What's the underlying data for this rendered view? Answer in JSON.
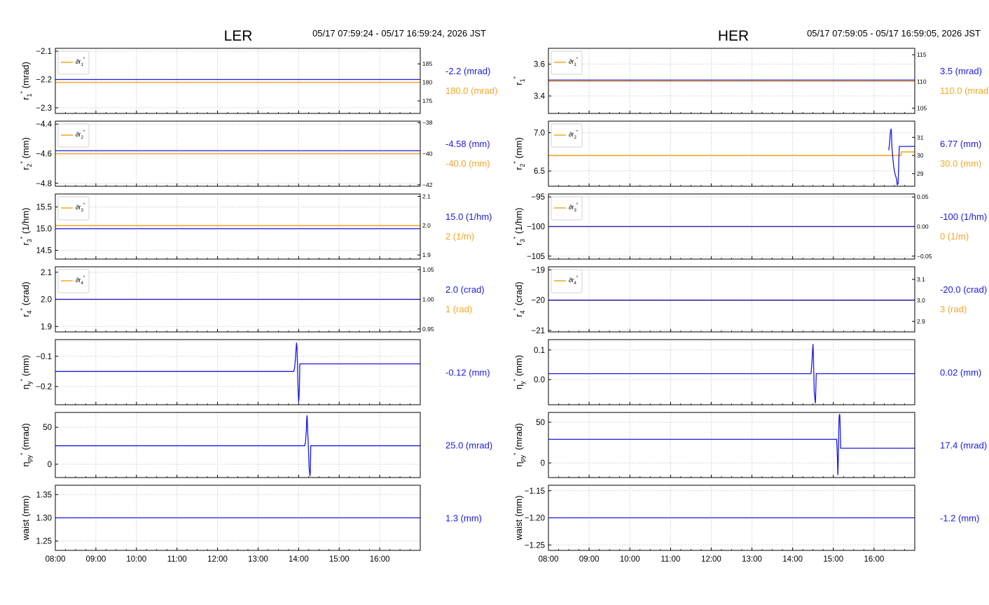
{
  "colors": {
    "blue": "#1a1ae6",
    "orange": "#f5a623",
    "grid": "#cccccc"
  },
  "x_ticks": [
    "08:00",
    "09:00",
    "10:00",
    "11:00",
    "12:00",
    "13:00",
    "14:00",
    "15:00",
    "16:00"
  ],
  "chart_data": [
    {
      "panel": "LER",
      "title": "LER",
      "date_range": "05/17 07:59:24 - 05/17 16:59:24, 2026 JST",
      "rows": [
        {
          "ylabel_main": "r",
          "ylabel_sub": "1",
          "ylabel_unit": "(mrad)",
          "ylim": [
            -2.32,
            -2.09
          ],
          "yticks": [
            -2.1,
            -2.2,
            -2.3
          ],
          "yticklabels": [
            "−2.1",
            "−2.2",
            "−2.3"
          ],
          "right_ylim": [
            171.6,
            189.2
          ],
          "right_yticks": [
            185,
            180,
            175
          ],
          "right_yticklabels": [
            "185",
            "180",
            "175"
          ],
          "legend": "∂r",
          "legend_sub": "1",
          "orange": [
            [
              0,
              180
            ],
            [
              9,
              180
            ]
          ],
          "blue": [
            [
              0,
              -2.2
            ],
            [
              9,
              -2.2
            ]
          ],
          "value_blue": "-2.2 (mrad)",
          "value_orange": "180.0 (mrad)"
        },
        {
          "ylabel_main": "r",
          "ylabel_sub": "2",
          "ylabel_unit": "(mm)",
          "ylim": [
            -4.82,
            -4.38
          ],
          "yticks": [
            -4.4,
            -4.6,
            -4.8
          ],
          "yticklabels": [
            "−4.4",
            "−4.6",
            "−4.8"
          ],
          "right_ylim": [
            -42.1,
            -37.9
          ],
          "right_yticks": [
            -38,
            -40,
            -42
          ],
          "right_yticklabels": [
            "−38",
            "−40",
            "−42"
          ],
          "legend": "∂r",
          "legend_sub": "2",
          "orange": [
            [
              0,
              -40
            ],
            [
              9,
              -40
            ]
          ],
          "blue": [
            [
              0,
              -4.58
            ],
            [
              9,
              -4.58
            ]
          ],
          "value_blue": "-4.58 (mm)",
          "value_orange": "-40.0 (mm)"
        },
        {
          "ylabel_main": "r",
          "ylabel_sub": "3",
          "ylabel_unit": "(1/hm)",
          "ylim": [
            14.3,
            15.8
          ],
          "yticks": [
            15.5,
            15.0,
            14.5
          ],
          "yticklabels": [
            "15.5",
            "15.0",
            "14.5"
          ],
          "right_ylim": [
            1.886,
            2.108
          ],
          "right_yticks": [
            2.1,
            2.0,
            1.9
          ],
          "right_yticklabels": [
            "2.1",
            "2.0",
            "1.9"
          ],
          "legend": "∂r",
          "legend_sub": "3",
          "orange": [
            [
              0,
              2.0
            ],
            [
              9,
              2.0
            ]
          ],
          "blue": [
            [
              0,
              15.0
            ],
            [
              9,
              15.0
            ]
          ],
          "value_blue": "15.0 (1/hm)",
          "value_orange": "2 (1/m)"
        },
        {
          "ylabel_main": "r",
          "ylabel_sub": "4",
          "ylabel_unit": "(crad)",
          "ylim": [
            1.88,
            2.12
          ],
          "yticks": [
            2.1,
            2.0,
            1.9
          ],
          "yticklabels": [
            "2.1",
            "2.0",
            "1.9"
          ],
          "right_ylim": [
            0.945,
            1.055
          ],
          "right_yticks": [
            1.05,
            1.0,
            0.95
          ],
          "right_yticklabels": [
            "1.05",
            "1.00",
            "0.95"
          ],
          "legend": "∂r",
          "legend_sub": "4",
          "orange": [
            [
              0,
              1.0
            ],
            [
              9,
              1.0
            ]
          ],
          "blue": [
            [
              0,
              2.0
            ],
            [
              9,
              2.0
            ]
          ],
          "value_blue": "2.0 (crad)",
          "value_orange": "1 (rad)"
        },
        {
          "ylabel_main": "η",
          "ylabel_sub": "y",
          "ylabel_unit": "(mm)",
          "ylim": [
            -0.26,
            -0.045
          ],
          "yticks": [
            -0.1,
            -0.2
          ],
          "yticklabels": [
            "−0.1",
            "−0.2"
          ],
          "blue": [
            [
              0,
              -0.15
            ],
            [
              5.88,
              -0.15
            ],
            [
              5.9,
              -0.14
            ],
            [
              5.92,
              -0.11
            ],
            [
              5.94,
              -0.07
            ],
            [
              5.95,
              -0.055
            ],
            [
              5.96,
              -0.07
            ],
            [
              5.97,
              -0.12
            ],
            [
              5.98,
              -0.18
            ],
            [
              5.99,
              -0.22
            ],
            [
              6.0,
              -0.25
            ],
            [
              6.01,
              -0.24
            ],
            [
              6.02,
              -0.2
            ],
            [
              6.03,
              -0.125
            ],
            [
              9,
              -0.125
            ]
          ],
          "value_blue": "-0.12 (mm)"
        },
        {
          "ylabel_main": "η",
          "ylabel_sub": "py",
          "ylabel_unit": "(mrad)",
          "ylim": [
            -18,
            70
          ],
          "yticks": [
            50,
            0
          ],
          "yticklabels": [
            "50",
            "0"
          ],
          "blue": [
            [
              0,
              25
            ],
            [
              6.15,
              25
            ],
            [
              6.17,
              30
            ],
            [
              6.19,
              45
            ],
            [
              6.2,
              62
            ],
            [
              6.21,
              66
            ],
            [
              6.22,
              50
            ],
            [
              6.24,
              25
            ],
            [
              6.26,
              -5
            ],
            [
              6.28,
              -16
            ],
            [
              6.29,
              -10
            ],
            [
              6.3,
              25
            ],
            [
              9,
              25
            ]
          ],
          "value_blue": "25.0 (mrad)"
        },
        {
          "ylabel_main": "waist",
          "ylabel_sub": "",
          "ylabel_unit": "(mm)",
          "ylim": [
            1.23,
            1.37
          ],
          "yticks": [
            1.35,
            1.3,
            1.25
          ],
          "yticklabels": [
            "1.35",
            "1.30",
            "1.25"
          ],
          "blue": [
            [
              0,
              1.3
            ],
            [
              9,
              1.3
            ]
          ],
          "value_blue": "1.3 (mm)"
        }
      ]
    },
    {
      "panel": "HER",
      "title": "HER",
      "date_range": "05/17 07:59:05 - 05/17 16:59:05, 2026 JST",
      "rows": [
        {
          "ylabel_main": "r",
          "ylabel_sub": "1",
          "ylabel_unit": "",
          "ylim": [
            3.29,
            3.7
          ],
          "yticks": [
            3.6,
            3.4
          ],
          "yticklabels": [
            "3.6",
            "3.4"
          ],
          "right_ylim": [
            104.0,
            116.2
          ],
          "right_yticks": [
            115,
            110,
            105
          ],
          "right_yticklabels": [
            "115",
            "110",
            "105"
          ],
          "legend": "∂r",
          "legend_sub": "1",
          "orange": [
            [
              0,
              110
            ],
            [
              9,
              110
            ]
          ],
          "blue": [
            [
              0,
              3.5
            ],
            [
              9,
              3.5
            ]
          ],
          "value_blue": "3.5 (mrad)",
          "value_orange": "110.0 (mrad)"
        },
        {
          "ylabel_main": "r",
          "ylabel_sub": "2",
          "ylabel_unit": "(mm)",
          "ylim": [
            6.3,
            7.15
          ],
          "yticks": [
            7.0,
            6.5
          ],
          "yticklabels": [
            "7.0",
            "6.5"
          ],
          "right_ylim": [
            28.3,
            31.9
          ],
          "right_yticks": [
            31,
            30,
            29
          ],
          "right_yticklabels": [
            "31",
            "30",
            "29"
          ],
          "legend": "∂r",
          "legend_sub": "2",
          "orange": [
            [
              0,
              30
            ],
            [
              8.66,
              30
            ],
            [
              8.67,
              30.2
            ],
            [
              9,
              30.2
            ]
          ],
          "blue": [
            [
              8.36,
              6.77
            ],
            [
              8.38,
              6.85
            ],
            [
              8.4,
              7.0
            ],
            [
              8.42,
              7.05
            ],
            [
              8.43,
              6.95
            ],
            [
              8.44,
              6.8
            ],
            [
              8.46,
              6.68
            ],
            [
              8.48,
              6.57
            ],
            [
              8.5,
              6.5
            ],
            [
              8.52,
              6.45
            ],
            [
              8.55,
              6.4
            ],
            [
              8.57,
              6.32
            ],
            [
              8.59,
              6.33
            ],
            [
              8.61,
              6.65
            ],
            [
              8.62,
              6.82
            ],
            [
              9,
              6.82
            ]
          ],
          "value_blue": "6.77 (mm)",
          "value_orange": "30.0 (mm)"
        },
        {
          "ylabel_main": "r",
          "ylabel_sub": "3",
          "ylabel_unit": "(1/hm)",
          "ylim": [
            -105.5,
            -94.5
          ],
          "yticks": [
            -95,
            -100,
            -105
          ],
          "yticklabels": [
            "−95",
            "−100",
            "−105"
          ],
          "right_ylim": [
            -0.055,
            0.055
          ],
          "right_yticks": [
            0.05,
            0.0,
            -0.05
          ],
          "right_yticklabels": [
            "0.05",
            "0.00",
            "−0.05"
          ],
          "legend": "∂r",
          "legend_sub": "3",
          "orange": [
            [
              0,
              0
            ],
            [
              9,
              0
            ]
          ],
          "blue": [
            [
              0,
              -100
            ],
            [
              9,
              -100
            ]
          ],
          "value_blue": "-100 (1/hm)",
          "value_orange": "0 (1/m)"
        },
        {
          "ylabel_main": "r",
          "ylabel_sub": "4",
          "ylabel_unit": "(crad)",
          "ylim": [
            -21.05,
            -18.9
          ],
          "yticks": [
            -19,
            -20,
            -21
          ],
          "yticklabels": [
            "−19",
            "−20",
            "−21"
          ],
          "right_ylim": [
            2.85,
            3.16
          ],
          "right_yticks": [
            3.1,
            3.0,
            2.9
          ],
          "right_yticklabels": [
            "3.1",
            "3.0",
            "2.9"
          ],
          "legend": "∂r",
          "legend_sub": "4",
          "orange": [
            [
              0,
              3.0
            ],
            [
              9,
              3.0
            ]
          ],
          "blue": [
            [
              0,
              -20
            ],
            [
              9,
              -20
            ]
          ],
          "value_blue": "-20.0 (crad)",
          "value_orange": "3 (rad)"
        },
        {
          "ylabel_main": "η",
          "ylabel_sub": "y",
          "ylabel_unit": "(mm)",
          "ylim": [
            -0.085,
            0.135
          ],
          "yticks": [
            0.1,
            0.0
          ],
          "yticklabels": [
            "0.1",
            "0.0"
          ],
          "blue": [
            [
              0,
              0.02
            ],
            [
              6.45,
              0.02
            ],
            [
              6.47,
              0.05
            ],
            [
              6.49,
              0.1
            ],
            [
              6.5,
              0.12
            ],
            [
              6.51,
              0.08
            ],
            [
              6.52,
              0.02
            ],
            [
              6.53,
              -0.04
            ],
            [
              6.55,
              -0.07
            ],
            [
              6.56,
              -0.08
            ],
            [
              6.57,
              -0.03
            ],
            [
              6.58,
              0.02
            ],
            [
              9,
              0.02
            ]
          ],
          "value_blue": "0.02 (mm)"
        },
        {
          "ylabel_main": "η",
          "ylabel_sub": "py",
          "ylabel_unit": "(mrad)",
          "ylim": [
            -18,
            62
          ],
          "yticks": [
            50,
            0
          ],
          "yticklabels": [
            "50",
            "0"
          ],
          "blue": [
            [
              0,
              29
            ],
            [
              7.08,
              29
            ],
            [
              7.09,
              20
            ],
            [
              7.1,
              5
            ],
            [
              7.11,
              -15
            ],
            [
              7.12,
              0
            ],
            [
              7.13,
              30
            ],
            [
              7.14,
              55
            ],
            [
              7.15,
              60
            ],
            [
              7.16,
              58
            ],
            [
              7.17,
              40
            ],
            [
              7.18,
              18
            ],
            [
              9,
              18
            ]
          ],
          "value_blue": "17.4 (mrad)"
        },
        {
          "ylabel_main": "waist",
          "ylabel_sub": "",
          "ylabel_unit": "(mm)",
          "ylim": [
            -1.26,
            -1.14
          ],
          "yticks": [
            -1.15,
            -1.2,
            -1.25
          ],
          "yticklabels": [
            "−1.15",
            "−1.20",
            "−1.25"
          ],
          "blue": [
            [
              0,
              -1.2
            ],
            [
              9,
              -1.2
            ]
          ],
          "value_blue": "-1.2 (mm)"
        }
      ]
    }
  ]
}
